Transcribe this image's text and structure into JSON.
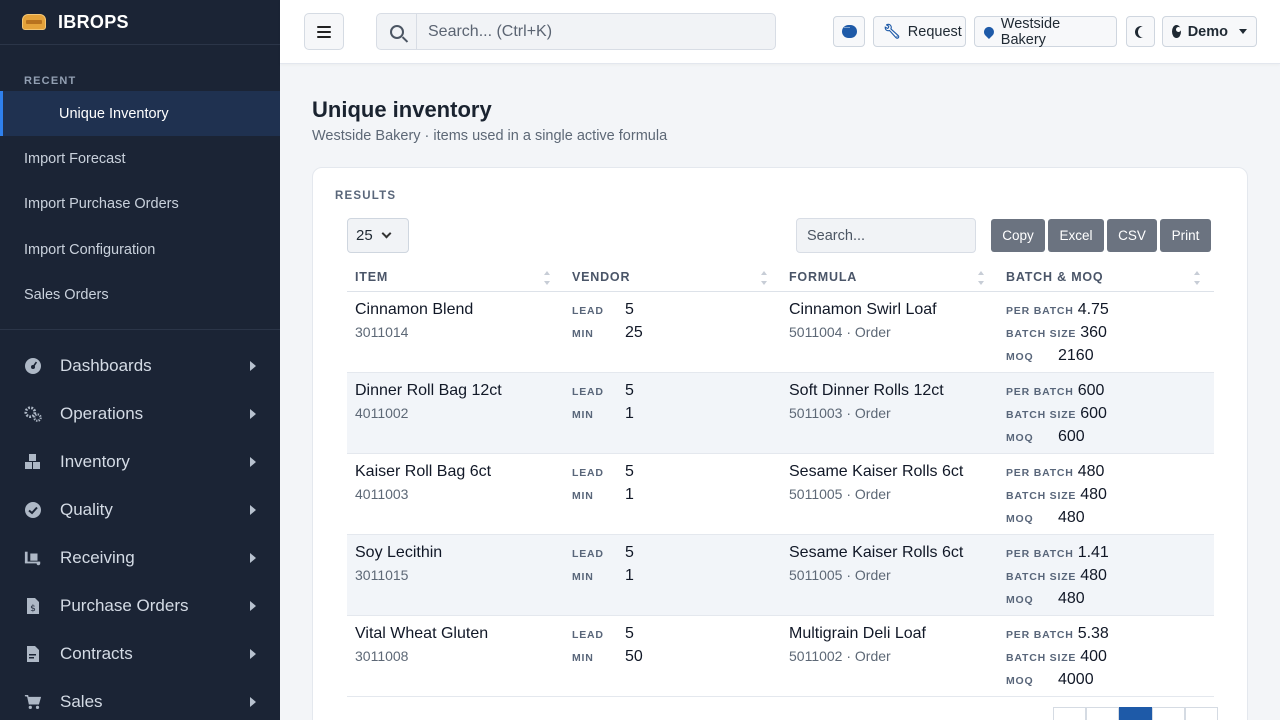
{
  "app": {
    "name": "IBROPS"
  },
  "sidebar": {
    "recent_title": "RECENT",
    "recent": [
      {
        "label": "Unique Inventory",
        "active": true
      },
      {
        "label": "Import Forecast"
      },
      {
        "label": "Import Purchase Orders"
      },
      {
        "label": "Import Configuration"
      },
      {
        "label": "Sales Orders"
      }
    ],
    "nav": [
      {
        "label": "Dashboards",
        "icon": "dashboard-icon"
      },
      {
        "label": "Operations",
        "icon": "gears-icon"
      },
      {
        "label": "Inventory",
        "icon": "boxes-icon"
      },
      {
        "label": "Quality",
        "icon": "check-circle-icon"
      },
      {
        "label": "Receiving",
        "icon": "truck-loading-icon"
      },
      {
        "label": "Purchase Orders",
        "icon": "invoice-dollar-icon"
      },
      {
        "label": "Contracts",
        "icon": "contract-icon"
      },
      {
        "label": "Sales",
        "icon": "cart-icon"
      }
    ]
  },
  "topbar": {
    "search_placeholder": "Search... (Ctrl+K)",
    "request_label": "Request",
    "location_label": "Westside Bakery",
    "user_label": "Demo"
  },
  "page": {
    "title": "Unique inventory",
    "subtitle": "Westside Bakery · items used in a single active formula"
  },
  "results": {
    "label": "RESULTS",
    "page_size": "25",
    "search_placeholder": "Search...",
    "export_buttons": [
      "Copy",
      "Excel",
      "CSV",
      "Print"
    ],
    "columns": [
      "ITEM",
      "VENDOR",
      "FORMULA",
      "BATCH & MOQ"
    ],
    "labels": {
      "lead": "LEAD",
      "min": "MIN",
      "per_batch": "PER BATCH",
      "batch_size": "BATCH SIZE",
      "moq": "MOQ"
    },
    "rows": [
      {
        "item": "Cinnamon Blend",
        "item_code": "3011014",
        "lead": "5",
        "min": "25",
        "formula": "Cinnamon Swirl Loaf",
        "formula_sub": "5011004 · Order",
        "per_batch": "4.75",
        "batch_size": "360",
        "moq": "2160"
      },
      {
        "item": "Dinner Roll Bag 12ct",
        "item_code": "4011002",
        "lead": "5",
        "min": "1",
        "formula": "Soft Dinner Rolls 12ct",
        "formula_sub": "5011003 · Order",
        "per_batch": "600",
        "batch_size": "600",
        "moq": "600"
      },
      {
        "item": "Kaiser Roll Bag 6ct",
        "item_code": "4011003",
        "lead": "5",
        "min": "1",
        "formula": "Sesame Kaiser Rolls 6ct",
        "formula_sub": "5011005 · Order",
        "per_batch": "480",
        "batch_size": "480",
        "moq": "480"
      },
      {
        "item": "Soy Lecithin",
        "item_code": "3011015",
        "lead": "5",
        "min": "1",
        "formula": "Sesame Kaiser Rolls 6ct",
        "formula_sub": "5011005 · Order",
        "per_batch": "1.41",
        "batch_size": "480",
        "moq": "480"
      },
      {
        "item": "Vital Wheat Gluten",
        "item_code": "3011008",
        "lead": "5",
        "min": "50",
        "formula": "Multigrain Deli Loaf",
        "formula_sub": "5011002 · Order",
        "per_batch": "5.38",
        "batch_size": "400",
        "moq": "4000"
      }
    ]
  }
}
